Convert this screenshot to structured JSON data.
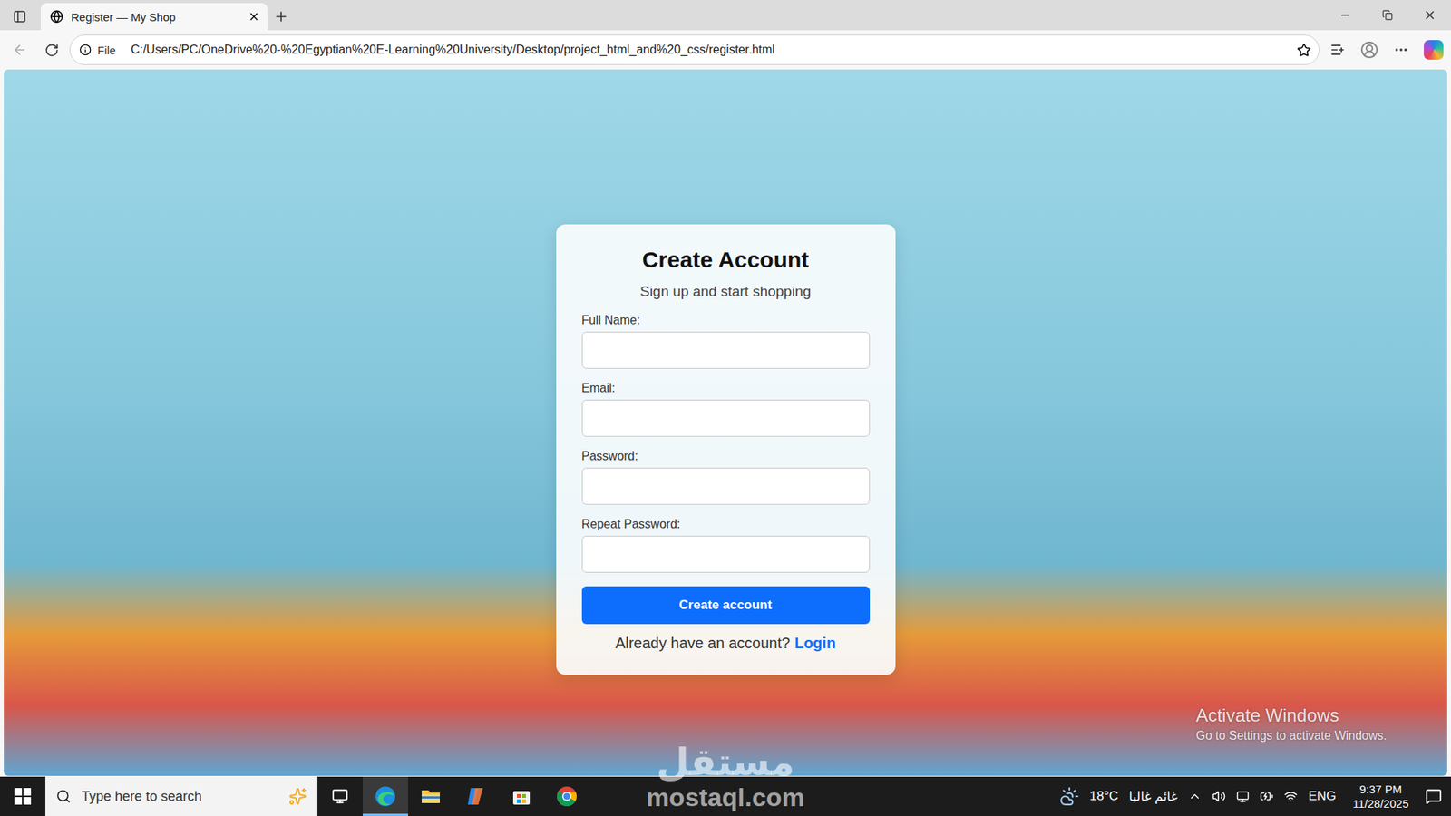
{
  "browser": {
    "tab": {
      "title": "Register — My Shop"
    },
    "address": {
      "scheme": "File",
      "url": "C:/Users/PC/OneDrive%20-%20Egyptian%20E-Learning%20University/Desktop/project_html_and%20_css/register.html"
    }
  },
  "page": {
    "title": "Create Account",
    "subtitle": "Sign up and start shopping",
    "fields": [
      {
        "label": "Full Name:",
        "kind": "text"
      },
      {
        "label": "Email:",
        "kind": "email"
      },
      {
        "label": "Password:",
        "kind": "password"
      },
      {
        "label": "Repeat Password:",
        "kind": "password"
      }
    ],
    "submit": "Create account",
    "footer": {
      "text": "Already have an account?",
      "link": "Login"
    }
  },
  "watermarks": {
    "windows_title": "Activate Windows",
    "windows_hint": "Go to Settings to activate Windows.",
    "site_logo": "مستقل",
    "site_url": "mostaql.com"
  },
  "taskbar": {
    "search_placeholder": "Type here to search",
    "apps": [
      {
        "name": "edge",
        "selected": true
      },
      {
        "name": "explorer",
        "selected": false
      },
      {
        "name": "copilot",
        "selected": false
      },
      {
        "name": "store",
        "selected": false
      },
      {
        "name": "chrome",
        "selected": false
      }
    ],
    "weather": {
      "temp": "18°C",
      "condition": "غائم غالبا"
    },
    "language": "ENG",
    "time": "9:37 PM",
    "date": "11/28/2025"
  }
}
